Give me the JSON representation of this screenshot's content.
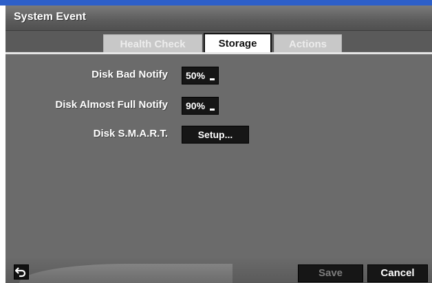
{
  "window": {
    "title": "System Event"
  },
  "tabs": [
    {
      "label": "Health Check",
      "active": false
    },
    {
      "label": "Storage",
      "active": true
    },
    {
      "label": "Actions",
      "active": false
    }
  ],
  "settings": {
    "disk_bad_notify": {
      "label": "Disk Bad Notify",
      "value": "50%"
    },
    "disk_almost_full_notify": {
      "label": "Disk Almost Full Notify",
      "value": "90%"
    },
    "disk_smart": {
      "label": "Disk S.M.A.R.T.",
      "button_label": "Setup..."
    }
  },
  "footer": {
    "back_icon": "return-arrow-icon",
    "save_label": "Save",
    "cancel_label": "Cancel"
  },
  "colors": {
    "background": "#6b6b6b",
    "accent_strip": "#2d5fc9",
    "control": "#161616",
    "disabled_text": "#7d7d7d"
  }
}
